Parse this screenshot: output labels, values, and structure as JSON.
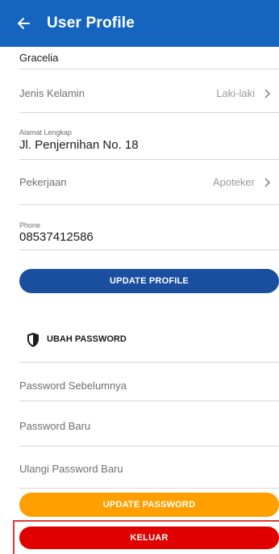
{
  "header": {
    "title": "User Profile",
    "back_icon": "arrow-left-icon",
    "background": "#1565c0"
  },
  "profile": {
    "name_value": "Gracelia",
    "gender": {
      "label": "Jenis Kelamin",
      "value": "Laki-laki"
    },
    "address": {
      "caption": "Alamat Lengkap",
      "value": "Jl. Penjernihan No. 18"
    },
    "job": {
      "label": "Pekerjaan",
      "value": "Apoteker"
    },
    "phone": {
      "caption": "Phone",
      "value": "08537412586"
    },
    "update_button": "UPDATE PROFILE"
  },
  "password": {
    "section_title": "UBAH PASSWORD",
    "section_icon": "shield-icon",
    "old_placeholder": "Password Sebelumnya",
    "new_placeholder": "Password Baru",
    "confirm_placeholder": "Ulangi Password Baru",
    "update_button": "UPDATE PASSWORD"
  },
  "logout_button": "KELUAR",
  "colors": {
    "primary": "#1a4fa0",
    "warning": "#ffa000",
    "danger": "#e00000"
  }
}
